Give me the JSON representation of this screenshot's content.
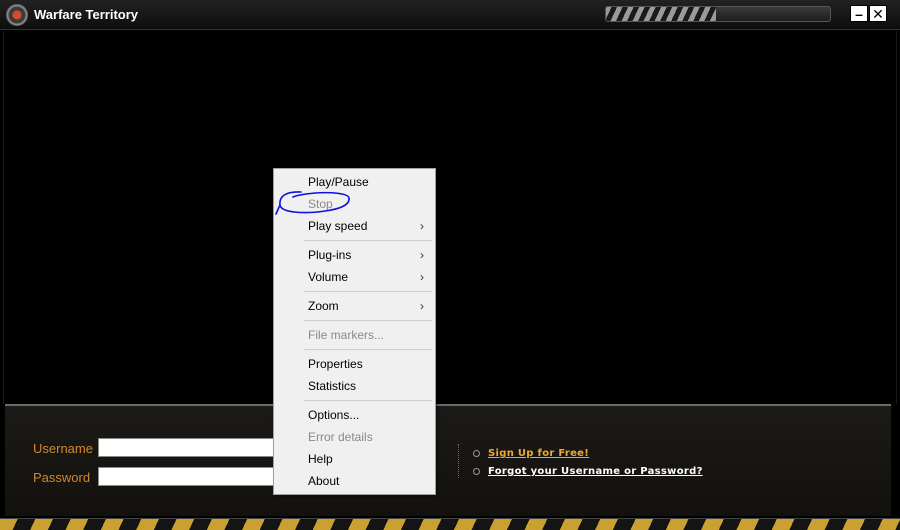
{
  "window": {
    "title": "Warfare Territory",
    "minimize_label": "–",
    "close_label": "✕",
    "icons": {
      "logo": "game-logo-icon"
    }
  },
  "login": {
    "username_label": "Username",
    "password_label": "Password",
    "username_value": "",
    "password_value": "",
    "signup_link": "Sign Up for Free!",
    "forgot_link": "Forgot your Username or Password?"
  },
  "context_menu": {
    "items": [
      {
        "label": "Play/Pause",
        "enabled": true,
        "submenu": false
      },
      {
        "label": "Stop",
        "enabled": false,
        "submenu": false
      },
      {
        "label": "Play speed",
        "enabled": true,
        "submenu": true
      },
      {
        "label": "Plug-ins",
        "enabled": true,
        "submenu": true
      },
      {
        "label": "Volume",
        "enabled": true,
        "submenu": true
      },
      {
        "label": "Zoom",
        "enabled": true,
        "submenu": true
      },
      {
        "label": "File markers...",
        "enabled": false,
        "submenu": false
      },
      {
        "label": "Properties",
        "enabled": true,
        "submenu": false
      },
      {
        "label": "Statistics",
        "enabled": true,
        "submenu": false
      },
      {
        "label": "Options...",
        "enabled": true,
        "submenu": false
      },
      {
        "label": "Error details",
        "enabled": false,
        "submenu": false
      },
      {
        "label": "Help",
        "enabled": true,
        "submenu": false
      },
      {
        "label": "About",
        "enabled": true,
        "submenu": false
      }
    ],
    "submenu_arrow": "›"
  },
  "colors": {
    "accent_orange": "#d2882c",
    "link_orange": "#f0a833",
    "annotation_blue": "#1010e0"
  }
}
